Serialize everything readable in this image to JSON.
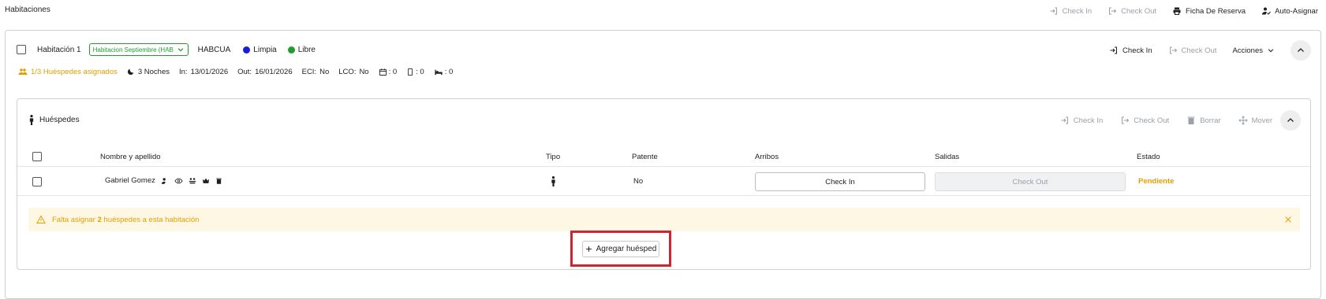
{
  "page": {
    "title": "Habitaciones"
  },
  "top_toolbar": {
    "check_in": "Check In",
    "check_out": "Check Out",
    "ficha": "Ficha De Reserva",
    "auto_asignar": "Auto-Asignar"
  },
  "room": {
    "name": "Habitación 1",
    "select_value": "Habitacion Septiembre (HABC",
    "code": "HABCUA",
    "clean_status": "Limpia",
    "occupancy_status": "Libre",
    "clean_color": "#1a1adb",
    "occupancy_color": "#1f9d2e",
    "check_in": "Check In",
    "check_out": "Check Out",
    "acciones": "Acciones",
    "guests_assigned": "1/3 Huéspedes asignados",
    "nights": "3 Noches",
    "in_label": "In:",
    "in_date": "13/01/2026",
    "out_label": "Out:",
    "out_date": "16/01/2026",
    "eci_label": "ECI:",
    "eci_value": "No",
    "lco_label": "LCO:",
    "lco_value": "No",
    "count_a": ": 0",
    "count_b": ": 0",
    "count_c": ": 0"
  },
  "guests_panel": {
    "title": "Huéspedes",
    "toolbar": {
      "check_in": "Check In",
      "check_out": "Check Out",
      "borrar": "Borrar",
      "mover": "Mover"
    },
    "columns": [
      "Nombre y apellido",
      "Tipo",
      "Patente",
      "Arribos",
      "Salidas",
      "Estado"
    ],
    "rows": [
      {
        "name": "Gabriel Gomez",
        "patente": "No",
        "arribo_button": "Check In",
        "salida_button": "Check Out",
        "estado": "Pendiente"
      }
    ],
    "warning": {
      "prefix": "Falta asignar ",
      "count": "2",
      "suffix": " huéspedes a esta habitación"
    },
    "add_button": "Agregar huésped"
  },
  "colors": {
    "accent_orange": "#e0a000",
    "warning_bg": "#fdf7e3",
    "highlight_red": "#d3232f"
  }
}
